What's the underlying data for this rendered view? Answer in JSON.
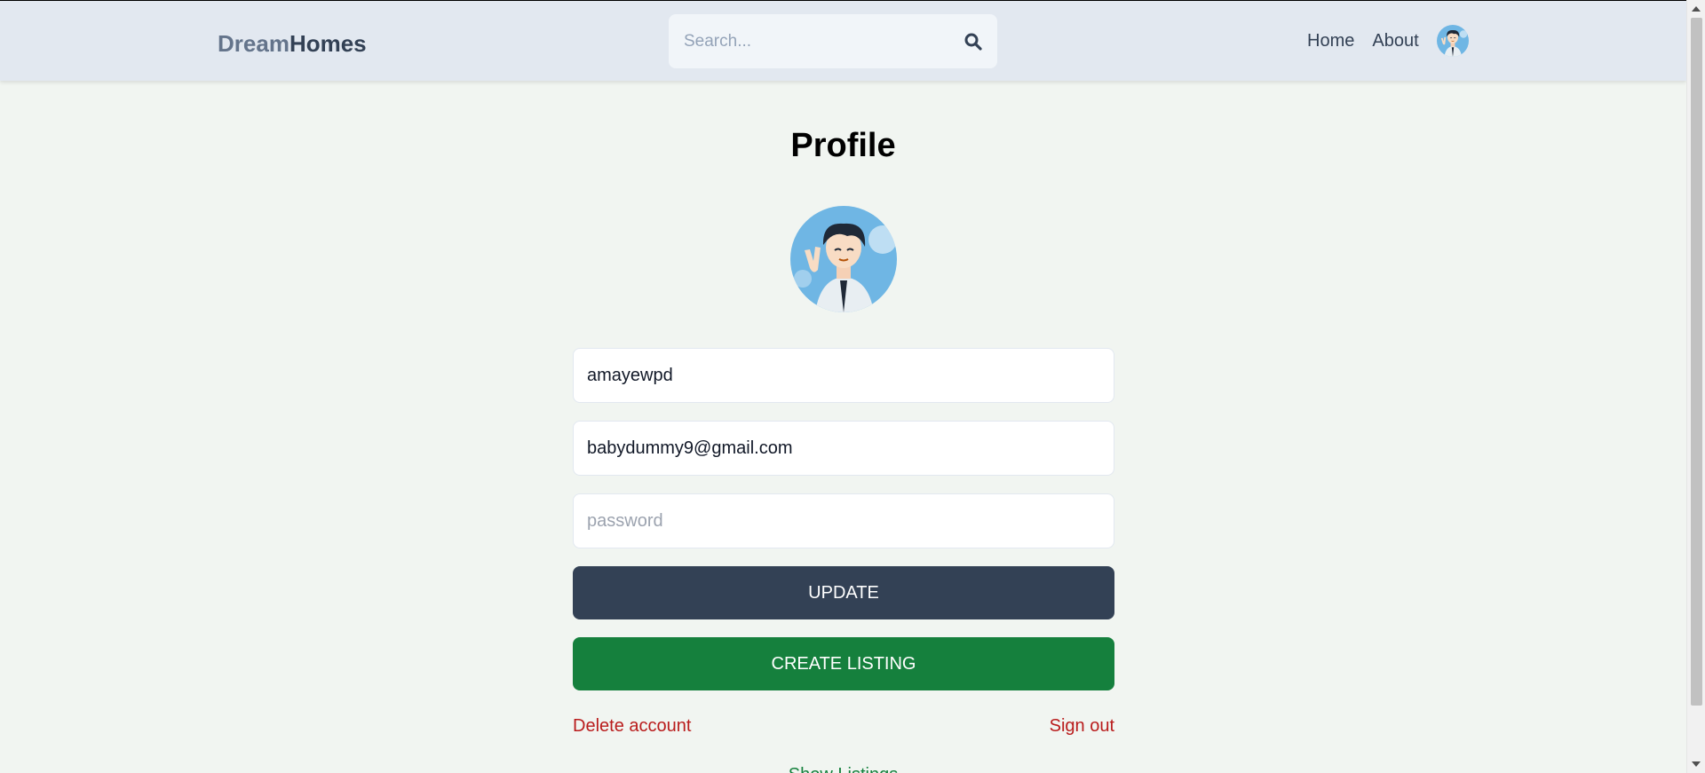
{
  "header": {
    "logo_part1": "Dream",
    "logo_part2": "Homes",
    "search_placeholder": "Search...",
    "search_icon": "search-icon",
    "nav": {
      "home": "Home",
      "about": "About"
    },
    "avatar_icon": "user-avatar"
  },
  "main": {
    "title": "Profile",
    "avatar_icon": "profile-avatar",
    "fields": {
      "username_value": "amayewpd",
      "email_value": "babydummy9@gmail.com",
      "password_placeholder": "password"
    },
    "buttons": {
      "update": "UPDATE",
      "create_listing": "CREATE LISTING"
    },
    "links": {
      "delete_account": "Delete account",
      "sign_out": "Sign out",
      "show_listings": "Show Listings"
    }
  },
  "colors": {
    "header_bg": "#e2e8f0",
    "page_bg": "#f1f5f1",
    "update_button": "#334155",
    "create_button": "#15803d",
    "danger_link": "#b91c1c"
  }
}
